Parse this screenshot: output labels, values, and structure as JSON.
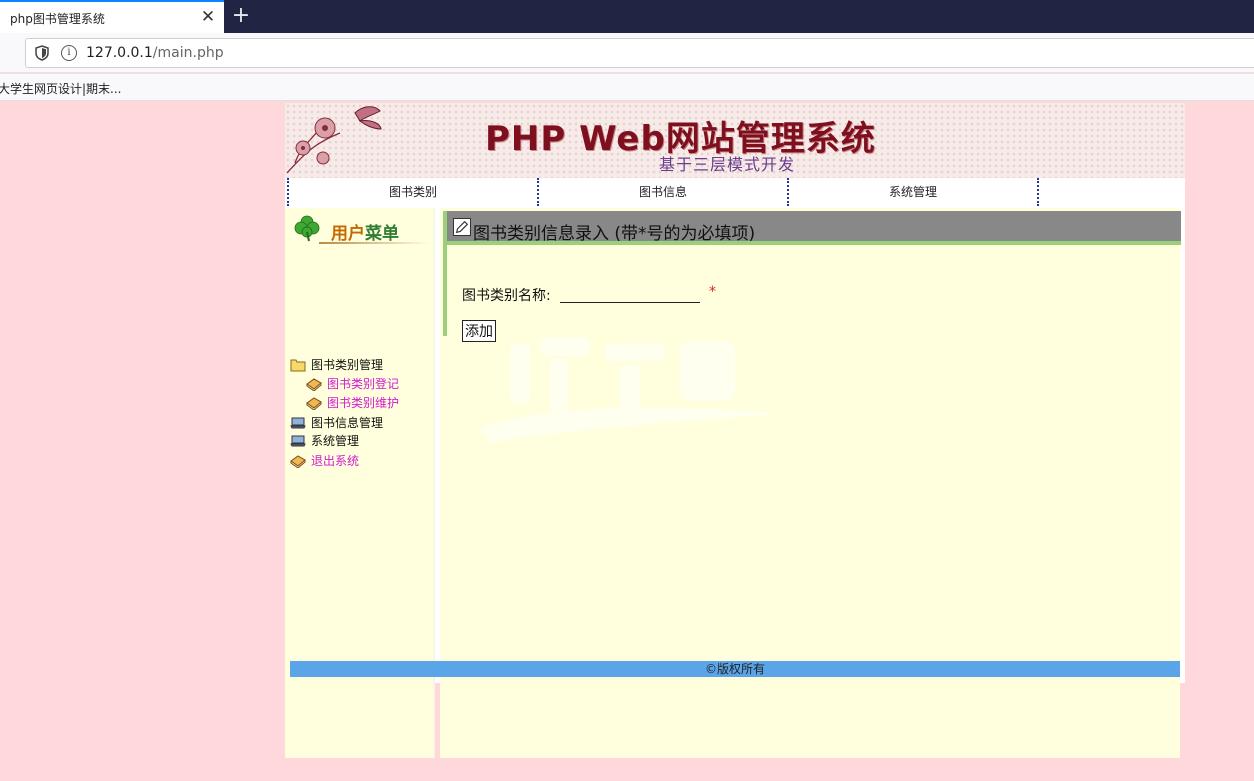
{
  "browser": {
    "tab_title": "php图书管理系统",
    "tab_close": "✕",
    "new_tab": "+",
    "url_host": "127.0.0.1",
    "url_path": "/main.php",
    "bookmark": "大学生网页设计|期末..."
  },
  "banner": {
    "title": "PHP Web网站管理系统",
    "subtitle": "基于三层模式开发"
  },
  "topnav": {
    "items": [
      "图书类别",
      "图书信息",
      "系统管理"
    ]
  },
  "sidebar": {
    "header_part1": "用户",
    "header_part2": "菜单",
    "items": [
      {
        "label": "图书类别管理",
        "icon": "folder-icon"
      },
      {
        "label": "图书类别登记",
        "icon": "book-icon"
      },
      {
        "label": "图书类别维护",
        "icon": "book-icon"
      },
      {
        "label": "图书信息管理",
        "icon": "computer-icon"
      },
      {
        "label": "系统管理",
        "icon": "computer-icon"
      },
      {
        "label": "退出系统",
        "icon": "book-icon"
      }
    ]
  },
  "form": {
    "title": "图书类别信息录入 (带*号的为必填项)",
    "field_label": "图书类别名称:",
    "field_value": "",
    "required_mark": "*",
    "submit_label": "添加"
  },
  "footer": {
    "text": "©版权所有"
  },
  "colors": {
    "page_bg": "#ffd8dc",
    "panel_bg": "#ffffdd",
    "header_bar": "#888888",
    "accent_green": "#9bd07a",
    "footer_bar": "#5aa4e8",
    "link_pink": "#d11bd1"
  }
}
